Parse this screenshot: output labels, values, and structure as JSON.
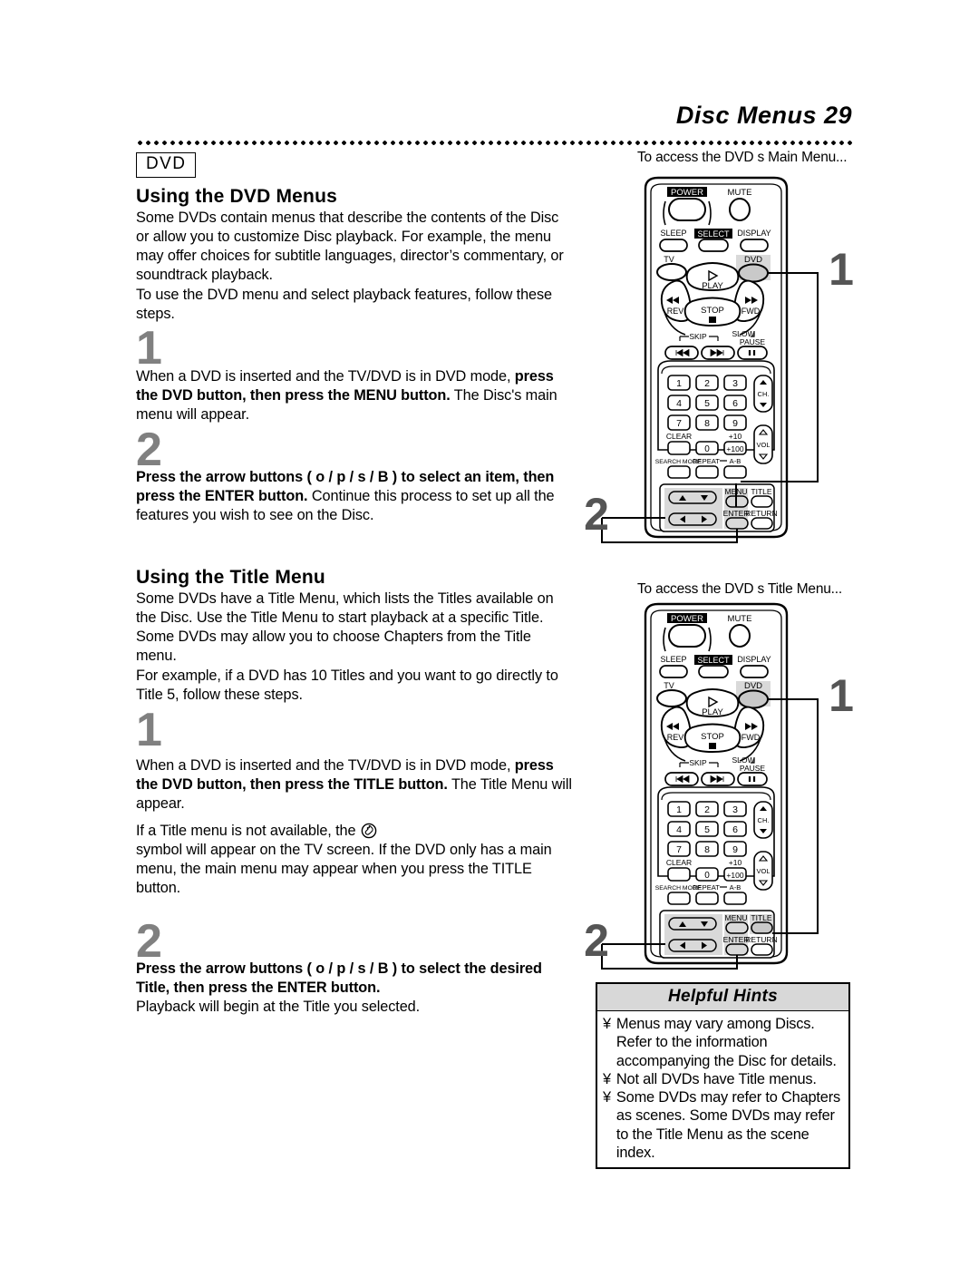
{
  "header": {
    "title": "Disc Menus  29"
  },
  "left": {
    "chip": "DVD",
    "section1": {
      "heading": "Using the DVD Menus",
      "para1": "Some DVDs contain menus that describe the contents of the Disc or allow you to customize Disc playback. For example, the menu may offer choices for subtitle languages, director’s commentary, or soundtrack playback.",
      "para2": "To use the DVD menu and select playback features, follow these steps.",
      "step1_num": "1",
      "step1_pre": "When a DVD is inserted and the TV/DVD is in DVD mode, ",
      "step1_bold": "press the DVD button, then press the MENU button.",
      "step1_post": " The Disc's main menu will appear.",
      "step2_num": "2",
      "step2_bold": "Press the arrow buttons ( o / p / s / B ) to select an item, then press the ENTER button.",
      "step2_post": " Continue this process to set up all the features you wish to see on the Disc."
    },
    "section2": {
      "heading": "Using the Title Menu",
      "para1": "Some DVDs have a Title Menu, which lists the Titles available on the Disc. Use the Title Menu to start playback at a specific Title. Some DVDs may allow you to choose Chapters from the Title menu.",
      "para2": "For example, if a DVD has 10 Titles and you want to go directly to Title 5, follow these steps.",
      "step1_num": "1",
      "step1_pre": "When a DVD is inserted and the TV/DVD is in DVD mode, ",
      "step1_bold": "press the DVD button, then press the TITLE button.",
      "step1_post": " The Title Menu will appear.",
      "note_pre": "If a Title menu is not available, the ",
      "note_post": "symbol will appear on the TV screen. If the DVD only has a main menu, the main menu may appear when you press the TITLE button.",
      "step2_num": "2",
      "step2_bold": "Press the arrow buttons ( o / p / s / B ) to select the desired Title, then press the ENTER button.",
      "step2_post": "Playback will begin at the Title you selected."
    }
  },
  "right": {
    "caption_main": "To access the DVD s Main Menu...",
    "caption_title": "To access the DVD s Title Menu...",
    "callout_1": "1",
    "callout_2": "2",
    "remote": {
      "power": "POWER",
      "mute": "MUTE",
      "sleep": "SLEEP",
      "select": "SELECT",
      "display": "DISPLAY",
      "tv": "TV",
      "dvd": "DVD",
      "play": "PLAY",
      "rev": "REV",
      "fwd": "FWD",
      "stop": "STOP",
      "skip": "SKIP",
      "slow": "SLOW",
      "pause": "PAUSE",
      "keys": [
        "1",
        "2",
        "3",
        "4",
        "5",
        "6",
        "7",
        "8",
        "9"
      ],
      "clear": "CLEAR",
      "zero": "0",
      "plus10": "+10",
      "plus100": "+100",
      "search_mode": "SEARCH MODE",
      "repeat": "REPEAT",
      "ab": "A-B",
      "ch": "CH.",
      "vol": "VOL",
      "menu": "MENU",
      "title": "TITLE",
      "enter": "ENTER",
      "return": "RETURN"
    }
  },
  "hints": {
    "heading": "Helpful Hints",
    "bullet": "¥",
    "items": [
      "Menus may vary among Discs. Refer to the information accompanying the Disc for details.",
      "Not all DVDs have Title menus.",
      "Some DVDs may refer to Chapters as  scenes.  Some DVDs may refer to the Title Menu as the  scene index."
    ]
  },
  "colors": {
    "step_number": "#808080",
    "hints_header_bg": "#d8d8d8",
    "highlight": "#d9d9d9"
  }
}
